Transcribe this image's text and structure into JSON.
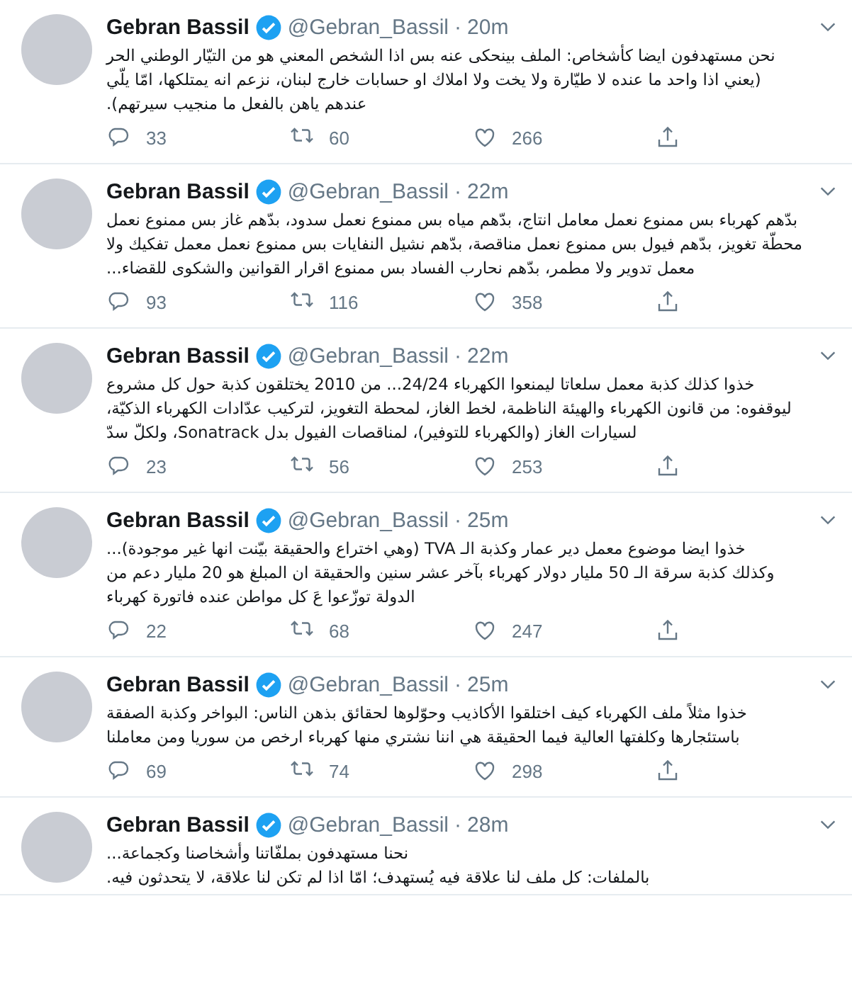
{
  "tweets": [
    {
      "name": "Gebran Bassil",
      "handle": "@Gebran_Bassil",
      "separator": "·",
      "time": "20m",
      "lines": [
        "نحن مستهدفون ايضا كأشخاص: الملف بينحكى عنه بس اذا الشخص المعني هو من التيّار الوطني الحر",
        "(يعني اذا واحد ما عنده لا طيّارة ولا يخت ولا املاك او حسابات خارج لبنان، نزعم انه يمتلكها، امّا يلّي",
        "عندهم ياهن بالفعل ما منجيب سيرتهم)."
      ],
      "replies": "33",
      "retweets": "60",
      "likes": "266"
    },
    {
      "name": "Gebran Bassil",
      "handle": "@Gebran_Bassil",
      "separator": "·",
      "time": "22m",
      "lines": [
        "بدّهم كهرباء بس ممنوع نعمل معامل انتاج، بدّهم مياه بس ممنوع نعمل سدود، بدّهم غاز بس ممنوع نعمل",
        "محطّة تغويز، بدّهم فيول بس ممنوع نعمل مناقصة، بدّهم نشيل النفايات بس ممنوع نعمل معمل تفكيك ولا",
        "معمل تدوير ولا مطمر، بدّهم نحارب الفساد بس ممنوع اقرار القوانين والشكوى للقضاء..."
      ],
      "replies": "93",
      "retweets": "116",
      "likes": "358"
    },
    {
      "name": "Gebran Bassil",
      "handle": "@Gebran_Bassil",
      "separator": "·",
      "time": "22m",
      "lines": [
        "خذوا كذلك كذبة معمل سلعاتا ليمنعوا الكهرباء 24/24... من 2010 يختلقون كذبة حول كل مشروع",
        "ليوقفوه: من قانون الكهرباء والهيئة الناظمة، لخط الغاز، لمحطة التغويز، لتركيب عدّادات الكهرباء الذكيّة،",
        "لسيارات الغاز (والكهرباء للتوفير)، لمناقصات الفيول بدل Sonatrack، ولكلّ سدّ"
      ],
      "replies": "23",
      "retweets": "56",
      "likes": "253"
    },
    {
      "name": "Gebran Bassil",
      "handle": "@Gebran_Bassil",
      "separator": "·",
      "time": "25m",
      "lines": [
        "خذوا ايضا موضوع معمل دير عمار وكذبة الـ TVA (وهي اختراع والحقيقة بيّنت انها غير موجودة)...",
        "وكذلك كذبة سرقة الـ 50 مليار دولار كهرباء بآخر عشر سنين والحقيقة ان المبلغ هو 20 مليار دعم من",
        "الدولة توزّعوا عَ كل مواطن عنده فاتورة كهرباء"
      ],
      "replies": "22",
      "retweets": "68",
      "likes": "247"
    },
    {
      "name": "Gebran Bassil",
      "handle": "@Gebran_Bassil",
      "separator": "·",
      "time": "25m",
      "lines": [
        "خذوا مثلاً ملف الكهرباء كيف اختلقوا الأكاذيب وحوّلوها لحقائق بذهن الناس: البواخر وكذبة الصفقة",
        "باستئجارها وكلفتها العالية فيما الحقيقة هي اننا نشتري منها كهرباء ارخص من سوريا ومن معاملنا"
      ],
      "replies": "69",
      "retweets": "74",
      "likes": "298"
    },
    {
      "name": "Gebran Bassil",
      "handle": "@Gebran_Bassil",
      "separator": "·",
      "time": "28m",
      "lines": [
        "نحنا مستهدفون بملفّاتنا وأشخاصنا وكجماعة...",
        "بالملفات: كل ملف لنا علاقة فيه يُستهدف؛ امّا اذا لم تكن لنا علاقة، لا يتحدثون فيه."
      ]
    }
  ]
}
